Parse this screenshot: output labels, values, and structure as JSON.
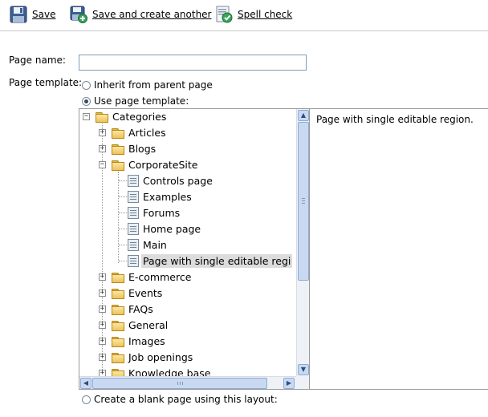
{
  "toolbar": {
    "save_label": "Save",
    "save_create_label": "Save and create another",
    "spell_check_label": "Spell check"
  },
  "form": {
    "page_name_label": "Page name:",
    "page_name_value": "",
    "page_template_label": "Page template:",
    "options": {
      "inherit": "Inherit from parent page",
      "use_template": "Use page template:",
      "blank": "Create a blank page using this layout:"
    },
    "selected_option": "use_template"
  },
  "tree": {
    "root": "Categories",
    "items": [
      {
        "label": "Articles"
      },
      {
        "label": "Blogs"
      },
      {
        "label": "CorporateSite"
      },
      {
        "label": "Controls page"
      },
      {
        "label": "Examples"
      },
      {
        "label": "Forums"
      },
      {
        "label": "Home page"
      },
      {
        "label": "Main"
      },
      {
        "label": "Page with single editable regi"
      },
      {
        "label": "E-commerce"
      },
      {
        "label": "Events"
      },
      {
        "label": "FAQs"
      },
      {
        "label": "General"
      },
      {
        "label": "Images"
      },
      {
        "label": "Job openings"
      },
      {
        "label": "Knowledge base"
      }
    ],
    "selected_item": "Page with single editable regi"
  },
  "description": "Page with single editable region.",
  "icons": {
    "save": "floppy-disk-icon",
    "save_create": "save-and-new-icon",
    "spell_check": "spell-check-icon",
    "folder": "folder-icon",
    "template": "page-template-icon"
  },
  "colors": {
    "selection": "#dcdcdc",
    "scrollbar_thumb": "#c9d9f1",
    "folder": "#eec35a",
    "border": "#9a9a9a"
  }
}
